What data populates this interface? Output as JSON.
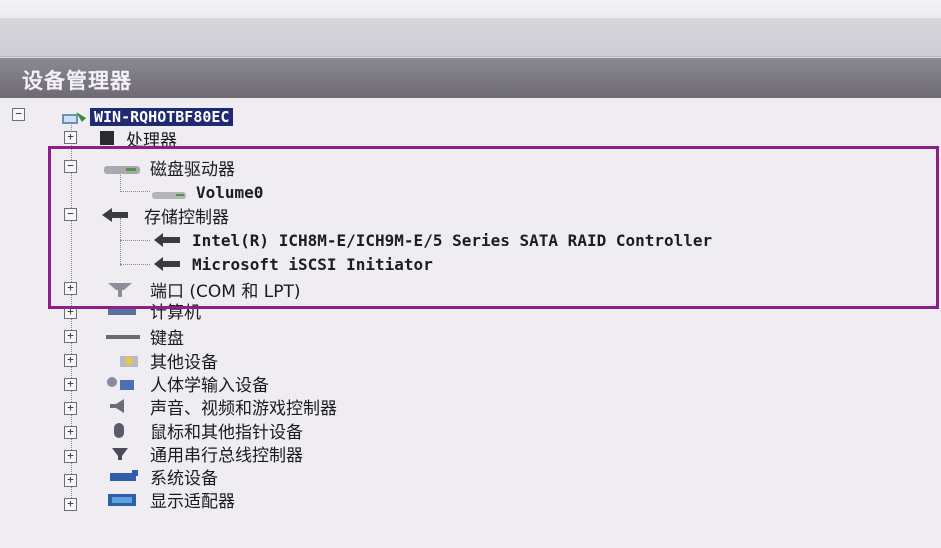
{
  "window": {
    "title": "设备管理器"
  },
  "tree": {
    "root": "WIN-RQHOTBF80EC",
    "items": [
      {
        "label": "处理器",
        "expander": "+"
      },
      {
        "label": "磁盘驱动器",
        "expander": "−"
      },
      {
        "label": "Volume0"
      },
      {
        "label": "存储控制器",
        "expander": "−"
      },
      {
        "label": "Intel(R) ICH8M-E/ICH9M-E/5 Series SATA RAID Controller"
      },
      {
        "label": "Microsoft iSCSI Initiator"
      },
      {
        "label": "端口 (COM 和 LPT)",
        "expander": "+"
      },
      {
        "label": "计算机",
        "expander": "+"
      },
      {
        "label": "键盘",
        "expander": "+"
      },
      {
        "label": "其他设备",
        "expander": "+"
      },
      {
        "label": "人体学输入设备",
        "expander": "+"
      },
      {
        "label": "声音、视频和游戏控制器",
        "expander": "+"
      },
      {
        "label": "鼠标和其他指针设备",
        "expander": "+"
      },
      {
        "label": "通用串行总线控制器",
        "expander": "+"
      },
      {
        "label": "系统设备",
        "expander": "+"
      },
      {
        "label": "显示适配器",
        "expander": "+"
      }
    ]
  },
  "colors": {
    "highlight_box": "#8c1f8c",
    "selection": "#1f2a73"
  }
}
